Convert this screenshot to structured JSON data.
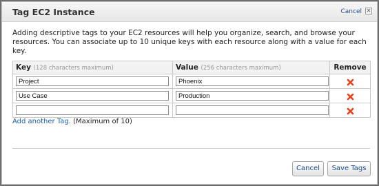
{
  "dialog": {
    "title": "Tag EC2 Instance",
    "cancel_link": "Cancel",
    "close_glyph": "✕",
    "description": "Adding descriptive tags to your EC2 resources will help you organize, search, and browse your resources. You can associate up to 10 unique keys with each resource along with a value for each key."
  },
  "table": {
    "key_header": "Key",
    "key_hint": "(128 characters maximum)",
    "value_header": "Value",
    "value_hint": "(256 characters maximum)",
    "remove_header": "Remove",
    "rows": [
      {
        "key": "Project",
        "value": "Phoenix"
      },
      {
        "key": "Use Case",
        "value": "Production"
      },
      {
        "key": "",
        "value": ""
      }
    ]
  },
  "add_tag": {
    "link": "Add another Tag.",
    "note": "(Maximum of 10)"
  },
  "buttons": {
    "cancel": "Cancel",
    "save": "Save Tags"
  },
  "colors": {
    "link": "#1e5fa8",
    "remove_icon": "#e8401c"
  }
}
